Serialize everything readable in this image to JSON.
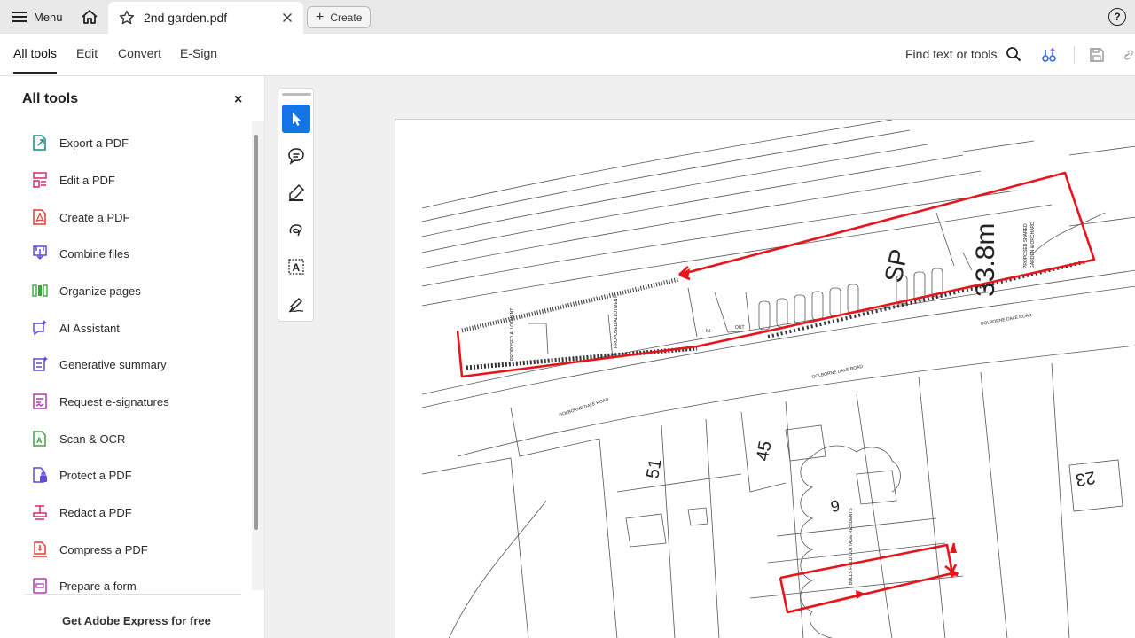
{
  "tabbar": {
    "menu_label": "Menu",
    "doc_tab_title": "2nd garden.pdf",
    "create_label": "Create",
    "help_glyph": "?"
  },
  "toolbar": {
    "tabs": [
      "All tools",
      "Edit",
      "Convert",
      "E-Sign"
    ],
    "active_tab": "All tools",
    "find_label": "Find text or tools"
  },
  "panel": {
    "title": "All tools",
    "close_glyph": "×",
    "items": [
      {
        "label": "Export a PDF",
        "icon": "export-pdf-icon",
        "color": "#1b8a7f"
      },
      {
        "label": "Edit a PDF",
        "icon": "edit-pdf-icon",
        "color": "#d6286b"
      },
      {
        "label": "Create a PDF",
        "icon": "create-pdf-icon",
        "color": "#e03c31"
      },
      {
        "label": "Combine files",
        "icon": "combine-files-icon",
        "color": "#5d4bd9"
      },
      {
        "label": "Organize pages",
        "icon": "organize-pages-icon",
        "color": "#3aa53a"
      },
      {
        "label": "AI Assistant",
        "icon": "ai-assistant-icon",
        "color": "#5d4bd9"
      },
      {
        "label": "Generative summary",
        "icon": "generative-summary-icon",
        "color": "#5d4bd9"
      },
      {
        "label": "Request e-signatures",
        "icon": "request-esignatures-icon",
        "color": "#b03aa8"
      },
      {
        "label": "Scan & OCR",
        "icon": "scan-ocr-icon",
        "color": "#3aa53a"
      },
      {
        "label": "Protect a PDF",
        "icon": "protect-pdf-icon",
        "color": "#5d4bd9"
      },
      {
        "label": "Redact a PDF",
        "icon": "redact-pdf-icon",
        "color": "#d6286b"
      },
      {
        "label": "Compress a PDF",
        "icon": "compress-pdf-icon",
        "color": "#e03c31"
      },
      {
        "label": "Prepare a form",
        "icon": "prepare-form-icon",
        "color": "#b03aa8"
      }
    ],
    "footer_link": "Get Adobe Express for free"
  },
  "quick_tools": [
    "select-icon",
    "comment-icon",
    "highlight-icon",
    "draw-icon",
    "text-box-icon",
    "sign-icon"
  ],
  "document": {
    "labels": {
      "sp": "SP",
      "dimension": "33.8m",
      "plot_51": "51",
      "plot_45": "45",
      "plot_9": "9",
      "plot_23": "23",
      "road_1": "GOLBORNE DALE ROAD",
      "road_2": "GOLBORNE DALE ROAD",
      "road_3": "GOLBORNE DALE ROAD",
      "proposed_shared": "PROPOSED SHARED",
      "garden_orchard": "GARDEN & ORCHARD",
      "allotment_1": "PROPOSED ALLOTMENT",
      "allotment_2": "PROPOSED ALLOTMENT",
      "bullsfield": "BULLS FIELD COTTAGE RESIDENTS",
      "in": "IN",
      "out": "OUT"
    },
    "annotation_color": "#e8141b"
  }
}
